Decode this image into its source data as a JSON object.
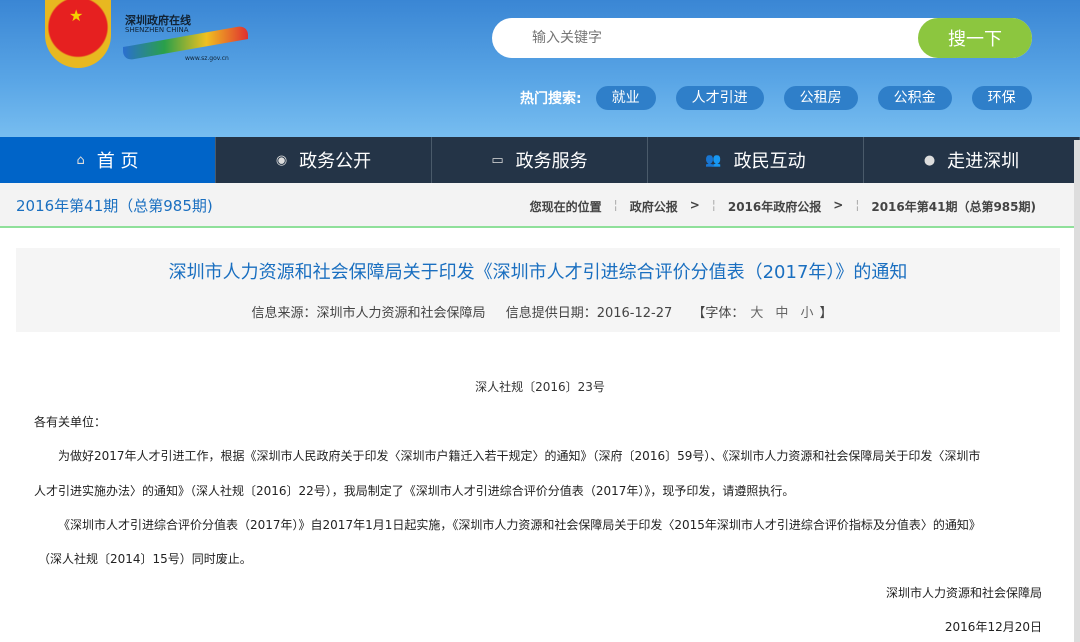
{
  "header": {
    "logo_cn": "深圳政府在线",
    "logo_en": "SHENZHEN CHINA",
    "logo_url": "www.sz.gov.cn",
    "search_placeholder": "输入关键字",
    "search_button": "搜一下",
    "hot_label": "热门搜索:",
    "hot_tags": [
      "就业",
      "人才引进",
      "公租房",
      "公积金",
      "环保"
    ]
  },
  "nav": [
    {
      "label": "首 页",
      "icon": "home-icon"
    },
    {
      "label": "政务公开",
      "icon": "news-icon"
    },
    {
      "label": "政务服务",
      "icon": "monitor-icon"
    },
    {
      "label": "政民互动",
      "icon": "users-icon"
    },
    {
      "label": "走进深圳",
      "icon": "chat-icon"
    }
  ],
  "breadcrumb": {
    "issue": "2016年第41期（总第985期)",
    "items": [
      "您现在的位置",
      "政府公报",
      ">",
      "2016年政府公报",
      ">",
      "2016年第41期（总第985期)"
    ]
  },
  "article": {
    "title": "深圳市人力资源和社会保障局关于印发《深圳市人才引进综合评价分值表（2017年）》的通知",
    "source": "信息来源：深圳市人力资源和社会保障局",
    "date": "信息提供日期：2016-12-27",
    "font_label": "【字体：",
    "font_sizes": [
      "大",
      "中",
      "小"
    ],
    "font_end": "】",
    "doc_no": "深人社规〔2016〕23号",
    "salutation": "各有关单位：",
    "lines": [
      "为做好2017年人才引进工作，根据《深圳市人民政府关于印发〈深圳市户籍迁入若干规定〉的通知》（深府〔2016〕59号）、《深圳市人力资源和社会保障局关于印发〈深圳市",
      "人才引进实施办法〉的通知》（深人社规〔2016〕22号），我局制定了《深圳市人才引进综合评价分值表（2017年）》，现予印发，请遵照执行。",
      "《深圳市人才引进综合评价分值表（2017年）》自2017年1月1日起实施，《深圳市人力资源和社会保障局关于印发〈2015年深圳市人才引进综合评价指标及分值表〉的通知》",
      "（深人社规〔2014〕15号）同时废止。"
    ],
    "signer": "深圳市人力资源和社会保障局",
    "sign_date": "2016年12月20日"
  }
}
